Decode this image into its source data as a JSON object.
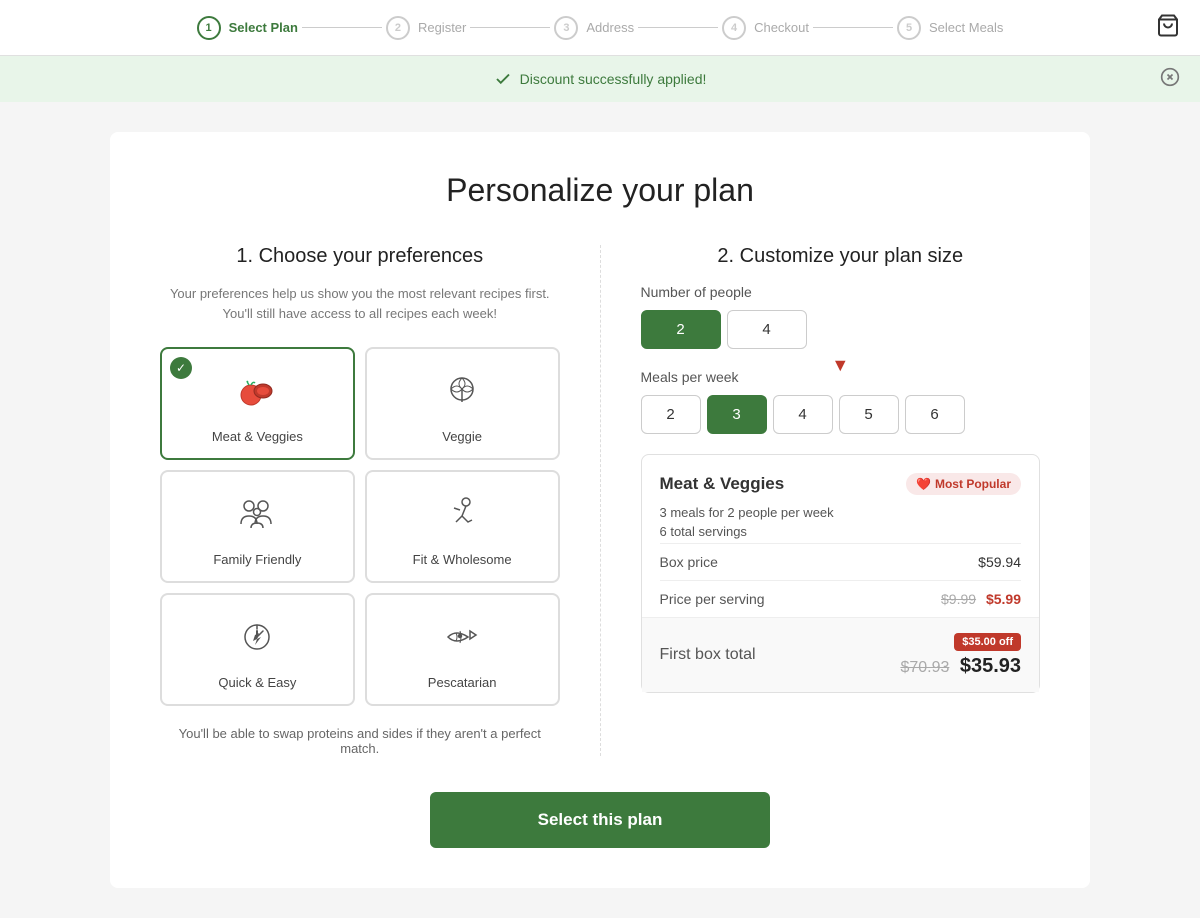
{
  "nav": {
    "steps": [
      {
        "number": "1",
        "label": "Select Plan",
        "active": true
      },
      {
        "number": "2",
        "label": "Register",
        "active": false
      },
      {
        "number": "3",
        "label": "Address",
        "active": false
      },
      {
        "number": "4",
        "label": "Checkout",
        "active": false
      },
      {
        "number": "5",
        "label": "Select Meals",
        "active": false
      }
    ]
  },
  "banner": {
    "text": "Discount successfully applied!",
    "close_label": "×"
  },
  "page": {
    "title": "Personalize your plan",
    "section1_title": "1. Choose your preferences",
    "section1_subtitle": "Your preferences help us show you the most relevant recipes first. You'll still have access to all recipes each week!",
    "section2_title": "2. Customize your plan size"
  },
  "preferences": [
    {
      "id": "meat-veggies",
      "label": "Meat & Veggies",
      "selected": true
    },
    {
      "id": "veggie",
      "label": "Veggie",
      "selected": false
    },
    {
      "id": "family-friendly",
      "label": "Family Friendly",
      "selected": false
    },
    {
      "id": "fit-wholesome",
      "label": "Fit & Wholesome",
      "selected": false
    },
    {
      "id": "quick-easy",
      "label": "Quick & Easy",
      "selected": false
    },
    {
      "id": "pescatarian",
      "label": "Pescatarian",
      "selected": false
    }
  ],
  "swap_note": "You'll be able to swap proteins and sides if they aren't a perfect match.",
  "people_options": [
    "2",
    "4"
  ],
  "people_selected": "2",
  "meals_options": [
    "2",
    "3",
    "4",
    "5",
    "6"
  ],
  "meals_selected": "3",
  "number_of_people_label": "Number of people",
  "meals_per_week_label": "Meals per week",
  "summary": {
    "title": "Meat & Veggies",
    "badge": "Most Popular",
    "meals_desc": "3 meals for 2 people per week",
    "servings_desc": "6 total servings",
    "box_price_label": "Box price",
    "box_price_value": "$59.94",
    "price_per_serving_label": "Price per serving",
    "price_per_serving_original": "$9.99",
    "price_per_serving_discounted": "$5.99",
    "first_box_label": "First box total",
    "discount_tag": "$35.00 off",
    "first_box_original": "$70.93",
    "first_box_final": "$35.93"
  },
  "cta_label": "Select this plan"
}
